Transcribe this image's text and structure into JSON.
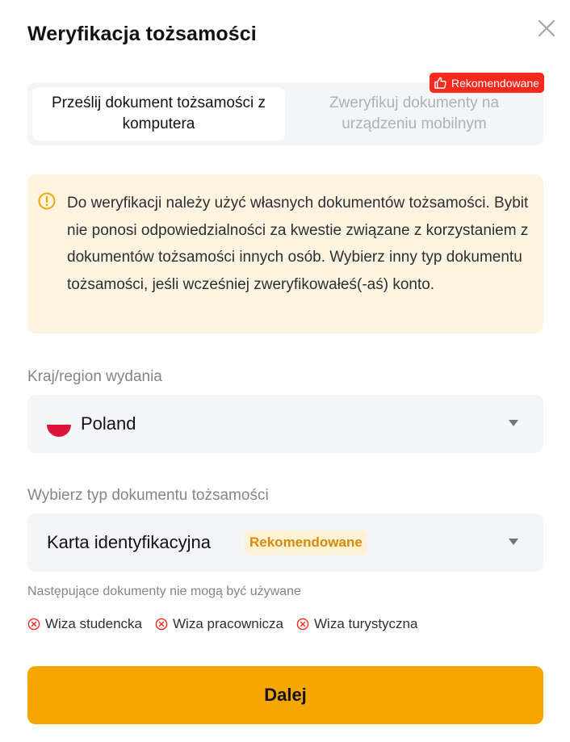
{
  "modal": {
    "title": "Weryfikacja tożsamości"
  },
  "tabs": [
    {
      "label": "Prześlij dokument tożsamości z komputera",
      "active": true
    },
    {
      "label": "Zweryfikuj dokumenty na urządzeniu mobilnym",
      "active": false
    }
  ],
  "recommended_badge": {
    "label": "Rekomendowane",
    "icon": "thumbs-up-icon",
    "color": "#f7281e"
  },
  "warning": {
    "icon": "exclamation-circle-icon",
    "text": "Do weryfikacji należy użyć własnych dokumentów tożsamości. Bybit nie ponosi odpowiedzialności za kwestie związane z korzystaniem z dokumentów tożsamości innych osób. Wybierz inny typ dokumentu tożsamości, jeśli wcześniej zweryfikowałeś(-aś) konto.",
    "background": "#fff4df",
    "icon_color": "#f7a600"
  },
  "country": {
    "label": "Kraj/region wydania",
    "value": "Poland",
    "flag": "poland-flag-icon"
  },
  "document_type": {
    "label": "Wybierz typ dokumentu tożsamości",
    "value": "Karta identyfikacyjna",
    "badge": "Rekomendowane"
  },
  "not_allowed": {
    "heading": "Następujące dokumenty nie mogą być używane",
    "items": [
      "Wiza studencka",
      "Wiza pracownicza",
      "Wiza turystyczna"
    ],
    "icon_color": "#f7281e"
  },
  "next_button": {
    "label": "Dalej",
    "color": "#f7a600"
  }
}
